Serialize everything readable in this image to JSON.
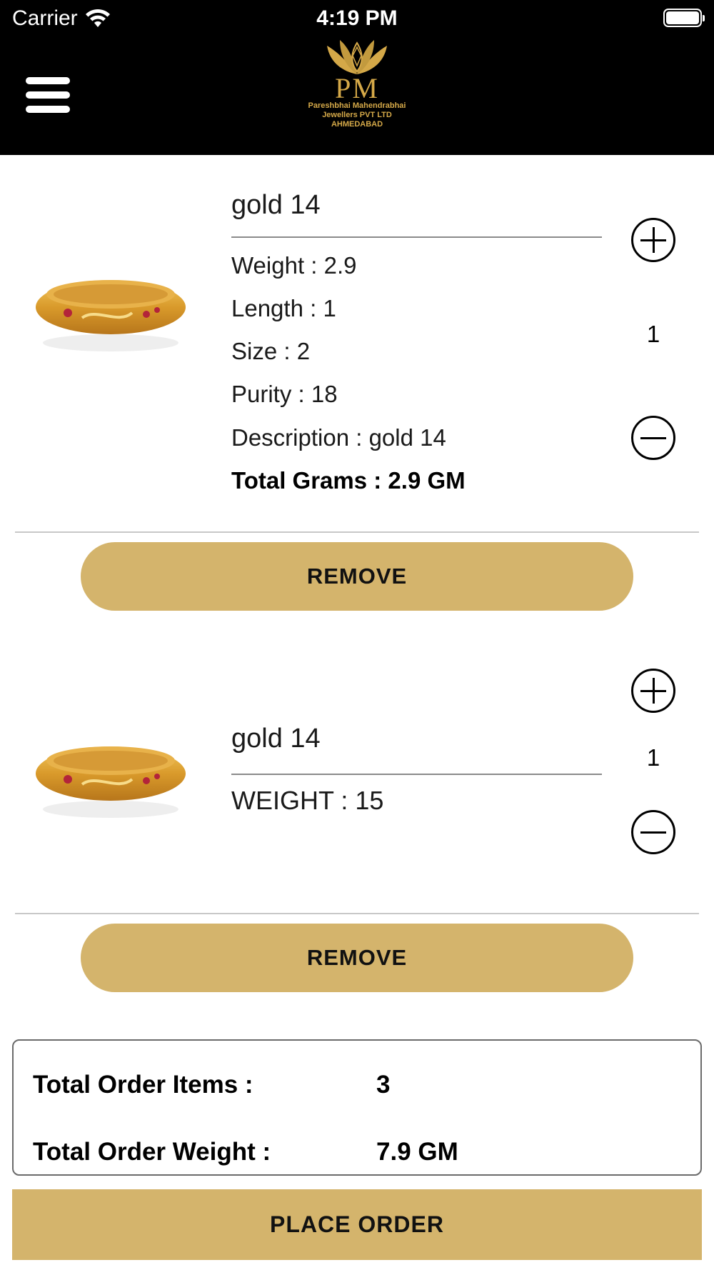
{
  "status_bar": {
    "carrier": "Carrier",
    "time": "4:19 PM"
  },
  "header": {
    "menu_icon": "hamburger-menu-icon",
    "logo": {
      "monogram": "PM",
      "line1": "Pareshbhai Mahendrabhai",
      "line2": "Jewellers PVT LTD",
      "line3": "AHMEDABAD",
      "color": "#d4a848"
    }
  },
  "cart": {
    "items": [
      {
        "name": "gold 14",
        "attributes": [
          "Weight : 2.9",
          "Length : 1",
          "Size : 2",
          "Purity : 18",
          "Description : gold 14"
        ],
        "total": "Total Grams : 2.9 GM",
        "quantity": "1",
        "remove_label": "REMOVE"
      },
      {
        "name": "gold 14",
        "attributes": [
          "WEIGHT : 15"
        ],
        "quantity": "1",
        "remove_label": "REMOVE"
      }
    ]
  },
  "summary": {
    "items_label": "Total Order Items :",
    "items_value": "3",
    "weight_label": "Total Order Weight :",
    "weight_value": "7.9 GM"
  },
  "place_order_label": "PLACE ORDER",
  "colors": {
    "header_bg": "#000000",
    "accent": "#d4b46c",
    "gold": "#d4a848"
  }
}
